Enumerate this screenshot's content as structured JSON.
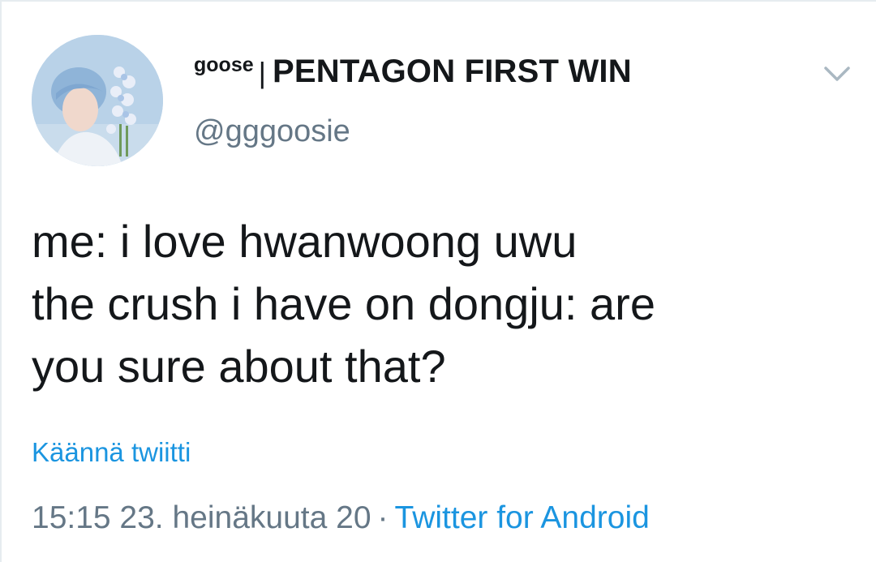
{
  "tweet": {
    "display_name_prefix": "goose",
    "display_name_separator": "|",
    "display_name_main": "PENTAGON FIRST WIN",
    "handle": "@gggoosie",
    "text_lines": [
      "me: i love hwanwoong uwu",
      "the crush i have on dongju: are",
      "you sure about that?"
    ],
    "translate_label": "Käännä twiitti",
    "timestamp": "15:15 23. heinäkuuta 20",
    "meta_separator": "·",
    "source": "Twitter for Android"
  },
  "colors": {
    "text": "#14171a",
    "secondary": "#657786",
    "link": "#1b95e0",
    "border": "#e6ecf0"
  },
  "icons": {
    "menu": "chevron-down-icon",
    "avatar": "avatar"
  }
}
